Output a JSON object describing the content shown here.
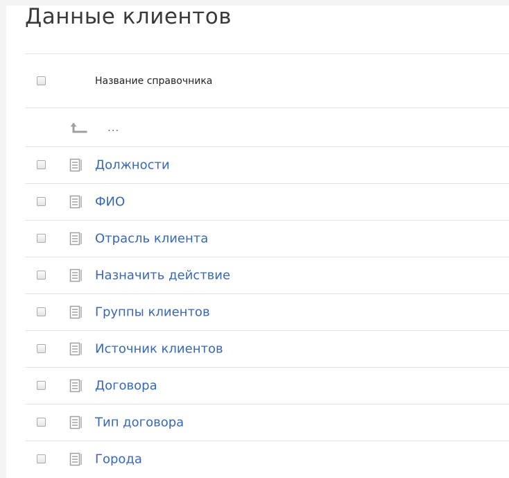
{
  "page": {
    "title": "Данные клиентов"
  },
  "table": {
    "header": {
      "column_label": "Название справочника"
    },
    "up_row": {
      "label": "..."
    },
    "items": [
      {
        "label": "Должности"
      },
      {
        "label": "ФИО"
      },
      {
        "label": "Отрасль клиента"
      },
      {
        "label": "Назначить действие"
      },
      {
        "label": "Группы клиентов"
      },
      {
        "label": "Источник клиентов"
      },
      {
        "label": "Договора"
      },
      {
        "label": "Тип договора"
      },
      {
        "label": "Города"
      }
    ]
  },
  "colors": {
    "link": "#3768b3",
    "title": "#3a3a3a",
    "border": "#e3e3e3",
    "icon": "#a0a0a0"
  }
}
